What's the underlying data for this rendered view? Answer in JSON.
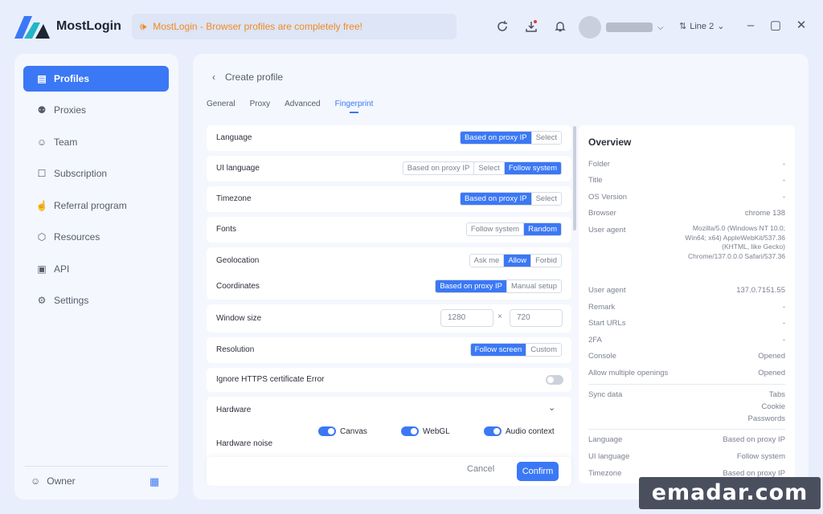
{
  "app": {
    "name": "MostLogin"
  },
  "banner": {
    "text": "MostLogin - Browser profiles are completely free!"
  },
  "topbar": {
    "line_label": "Line 2"
  },
  "colors": {
    "accent": "#3b78f5",
    "banner_text": "#f08a24",
    "background": "#e8eefc"
  },
  "sidebar": {
    "items": [
      {
        "label": "Profiles",
        "icon": "window-icon",
        "active": true
      },
      {
        "label": "Proxies",
        "icon": "proxy-icon",
        "active": false
      },
      {
        "label": "Team",
        "icon": "team-icon",
        "active": false
      },
      {
        "label": "Subscription",
        "icon": "bookmark-icon",
        "active": false
      },
      {
        "label": "Referral program",
        "icon": "thumbs-up-icon",
        "active": false
      },
      {
        "label": "Resources",
        "icon": "box-icon",
        "active": false
      },
      {
        "label": "API",
        "icon": "api-icon",
        "active": false
      },
      {
        "label": "Settings",
        "icon": "gear-icon",
        "active": false
      }
    ],
    "owner_label": "Owner"
  },
  "page": {
    "back_title": "Create profile",
    "tabs": [
      "General",
      "Proxy",
      "Advanced",
      "Fingerprint"
    ],
    "active_tab": "Fingerprint"
  },
  "form": {
    "language": {
      "label": "Language",
      "options": [
        "Based on proxy IP",
        "Select"
      ],
      "selected": "Based on proxy IP"
    },
    "ui_language": {
      "label": "UI language",
      "options": [
        "Based on proxy IP",
        "Select",
        "Follow system"
      ],
      "selected": "Follow system"
    },
    "timezone": {
      "label": "Timezone",
      "options": [
        "Based on proxy IP",
        "Select"
      ],
      "selected": "Based on proxy IP"
    },
    "fonts": {
      "label": "Fonts",
      "options": [
        "Follow system",
        "Random"
      ],
      "selected": "Random"
    },
    "geolocation": {
      "label": "Geolocation",
      "options": [
        "Ask me",
        "Allow",
        "Forbid"
      ],
      "selected": "Allow"
    },
    "coordinates": {
      "label": "Coordinates",
      "options": [
        "Based on proxy IP",
        "Manual setup"
      ],
      "selected": "Based on proxy IP"
    },
    "window_size": {
      "label": "Window size",
      "width": "1280",
      "separator": "×",
      "height": "720"
    },
    "resolution": {
      "label": "Resolution",
      "options": [
        "Follow screen",
        "Custom"
      ],
      "selected": "Follow screen"
    },
    "https_error": {
      "label": "Ignore HTTPS certificate Error",
      "enabled": false
    },
    "hardware": {
      "label": "Hardware"
    },
    "hardware_noise": {
      "label": "Hardware noise",
      "items": [
        {
          "label": "Canvas",
          "on": true
        },
        {
          "label": "WebGL",
          "on": true
        },
        {
          "label": "Audio context",
          "on": true
        }
      ]
    },
    "cancel_label": "Cancel",
    "confirm_label": "Confirm"
  },
  "overview": {
    "title": "Overview",
    "rows": [
      {
        "label": "Folder",
        "value": "-"
      },
      {
        "label": "Title",
        "value": "-"
      },
      {
        "label": "OS Version",
        "value": "-"
      },
      {
        "label": "Browser",
        "value": "chrome  138"
      },
      {
        "label": "User agent",
        "value": ""
      },
      {
        "label": "User agent",
        "value": "137.0.7151.55"
      },
      {
        "label": "Remark",
        "value": "-"
      },
      {
        "label": "Start URLs",
        "value": "-"
      },
      {
        "label": "2FA",
        "value": "-"
      },
      {
        "label": "Console",
        "value": "Opened"
      },
      {
        "label": "Allow multiple openings",
        "value": "Opened"
      }
    ],
    "user_agent_full": "Mozilla/5.0 (Windows NT 10.0; Win64; x64) AppleWebKit/537.36 (KHTML, like Gecko) Chrome/137.0.0.0 Safari/537.36",
    "sync": {
      "label": "Sync data",
      "values": [
        "Tabs",
        "Cookie",
        "Passwords"
      ]
    },
    "rows2": [
      {
        "label": "Language",
        "value": "Based on proxy IP"
      },
      {
        "label": "UI language",
        "value": "Follow system"
      },
      {
        "label": "Timezone",
        "value": "Based on proxy IP"
      }
    ]
  },
  "watermark": {
    "text": "emadar.com"
  }
}
